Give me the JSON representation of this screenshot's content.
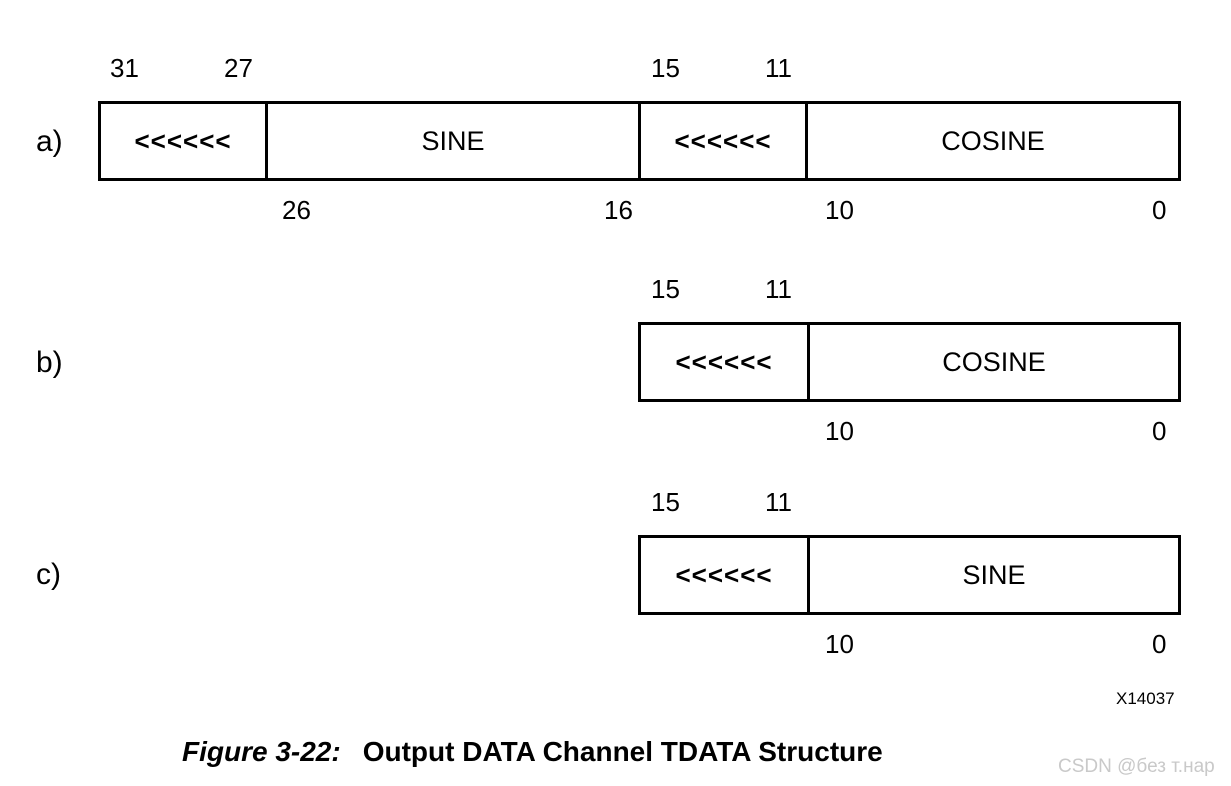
{
  "figure": {
    "code": "X14037",
    "caption_number": "Figure 3-22:",
    "caption_title": "Output DATA Channel TDATA Structure",
    "watermark": "CSDN @без т.нар"
  },
  "rows": [
    {
      "label": "a)",
      "top_ticks": [
        "31",
        "27",
        "15",
        "11"
      ],
      "bottom_ticks": [
        "26",
        "16",
        "10",
        "0"
      ],
      "cells": [
        {
          "text": "<<<<<<",
          "kind": "reserved"
        },
        {
          "text": "SINE",
          "kind": "field"
        },
        {
          "text": "<<<<<<",
          "kind": "reserved"
        },
        {
          "text": "COSINE",
          "kind": "field"
        }
      ]
    },
    {
      "label": "b)",
      "top_ticks": [
        "15",
        "11"
      ],
      "bottom_ticks": [
        "10",
        "0"
      ],
      "cells": [
        {
          "text": "<<<<<<",
          "kind": "reserved"
        },
        {
          "text": "COSINE",
          "kind": "field"
        }
      ]
    },
    {
      "label": "c)",
      "top_ticks": [
        "15",
        "11"
      ],
      "bottom_ticks": [
        "10",
        "0"
      ],
      "cells": [
        {
          "text": "<<<<<<",
          "kind": "reserved"
        },
        {
          "text": "SINE",
          "kind": "field"
        }
      ]
    }
  ]
}
